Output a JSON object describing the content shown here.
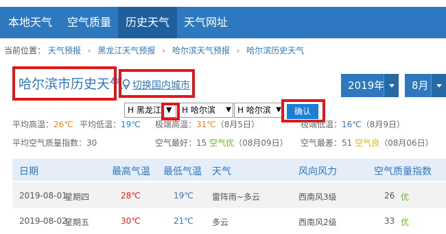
{
  "nav": {
    "tabs": [
      "本地天气",
      "空气质量",
      "历史天气",
      "天气网址"
    ],
    "active_index": 2
  },
  "breadcrumb": {
    "prefix": "当前位置：",
    "items": [
      "天气预报",
      "黑龙江天气预报",
      "哈尔滨天气预报",
      "哈尔滨历史天气"
    ],
    "separator": "›"
  },
  "section": {
    "title": "哈尔滨市历史天气",
    "switch_label": "切换国内城市"
  },
  "date_picker": {
    "year": "2019年",
    "month": "8月"
  },
  "city_selectors": {
    "province": "H 黑龙江",
    "city": "H 哈尔滨",
    "district": "H 哈尔滨",
    "dropdown_glyph": "▼",
    "confirm_label": "确认"
  },
  "stats": {
    "avg_high_label": "平均高温：",
    "avg_high_value": "26℃",
    "avg_low_label": "平均低温：",
    "avg_low_value": "19℃",
    "max_high_label": "极端高温：",
    "max_high_value": "31℃",
    "max_high_date": "（8月5日）",
    "min_low_label": "极端低温：",
    "min_low_value": "16℃",
    "min_low_date": "（8月9日）",
    "aqi_avg_label": "平均空气质量指数：",
    "aqi_avg_value": "30",
    "best_label": "空气最好：",
    "best_value": "15",
    "best_level": "空气优",
    "best_date": "（08月09日）",
    "worst_label": "空气最差：",
    "worst_value": "51",
    "worst_level": "空气良",
    "worst_date": "（08月06日）"
  },
  "table": {
    "headers": [
      "日期",
      "最高气温",
      "最低气温",
      "天气",
      "风向风力",
      "空气质量指数"
    ],
    "rows": [
      {
        "date": "2019-08-01",
        "weekday": "星期四",
        "high": "28℃",
        "low": "19℃",
        "weather": "雷阵雨~多云",
        "wind": "西南风3级",
        "aqi": "26",
        "aqi_level": "优"
      },
      {
        "date": "2019-08-02",
        "weekday": "星期五",
        "high": "30℃",
        "low": "21℃",
        "weather": "多云",
        "wind": "西南风2级",
        "aqi": "33",
        "aqi_level": "优"
      }
    ]
  },
  "colors": {
    "primary": "#2d78bf",
    "highlight_box": "#e0161b",
    "hot": "#f08519",
    "good": "#6ab820"
  }
}
